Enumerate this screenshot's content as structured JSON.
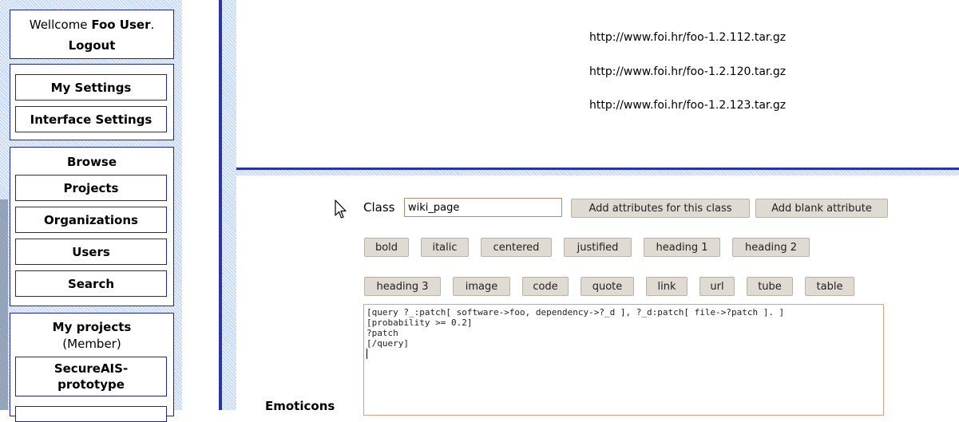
{
  "sidebar": {
    "welcome_prefix": "Wellcome",
    "user_name": "Foo User",
    "welcome_suffix": ".",
    "logout_label": "Logout",
    "settings_buttons": [
      "My Settings",
      "Interface Settings"
    ],
    "browse_heading": "Browse",
    "browse_buttons": [
      "Projects",
      "Organizations",
      "Users",
      "Search"
    ],
    "my_projects_heading": "My projects",
    "my_projects_subheading": "(Member)",
    "project_button": "SecureAIS-prototype"
  },
  "main": {
    "urls": [
      "http://www.foi.hr/foo-1.2.112.tar.gz",
      "http://www.foi.hr/foo-1.2.120.tar.gz",
      "http://www.foi.hr/foo-1.2.123.tar.gz"
    ],
    "class_label": "Class",
    "class_value": "wiki_page",
    "add_attributes_label": "Add attributes for this class",
    "add_blank_label": "Add blank attribute",
    "format_row1": [
      "bold",
      "italic",
      "centered",
      "justified",
      "heading 1",
      "heading 2"
    ],
    "format_row2": [
      "heading 3",
      "image",
      "code",
      "quote",
      "link",
      "url",
      "tube",
      "table"
    ],
    "editor_lines": [
      "[query ?_:patch[ software->foo, dependency->?_d ], ?_d:patch[ file->?patch ]. ]",
      "[probability >= 0.2]",
      "?patch",
      "[/query]"
    ],
    "emoticons_label": "Emoticons"
  }
}
